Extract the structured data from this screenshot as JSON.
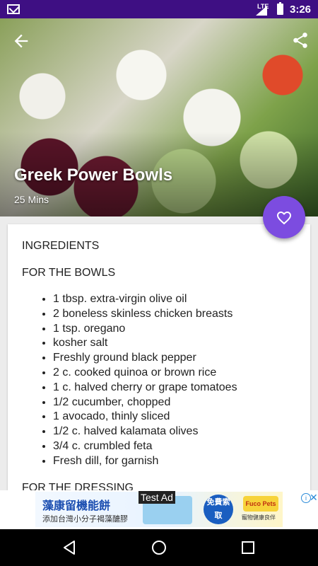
{
  "status_bar": {
    "network": "LTE",
    "time": "3:26"
  },
  "recipe": {
    "title": "Greek Power Bowls",
    "duration": "25 Mins"
  },
  "ingredients": {
    "heading": "INGREDIENTS",
    "bowls_heading": "FOR THE BOWLS",
    "bowls_items": [
      "1 tbsp. extra-virgin olive oil",
      "2 boneless skinless chicken breasts",
      "1 tsp. oregano",
      "kosher salt",
      "Freshly ground black pepper",
      "2 c. cooked quinoa or brown rice",
      "1 c. halved cherry or grape tomatoes",
      "1/2 cucumber, chopped",
      "1 avocado, thinly sliced",
      "1/2 c. halved kalamata olives",
      "3/4 c. crumbled feta",
      "Fresh dill, for garnish"
    ],
    "dressing_heading": "FOR THE DRESSING"
  },
  "ad": {
    "label": "Test Ad",
    "headline": "藻康留機能餅",
    "subline": "添加台灣小分子褐藻醣膠",
    "cta": "免費索取",
    "brand": "Fuco Pets",
    "brand_sub": "寵物健康良伴",
    "info": "i",
    "close": "✕"
  },
  "colors": {
    "status_bar": "#3e0f83",
    "fab": "#7c4ce0"
  },
  "icons": {
    "back": "arrow-back-icon",
    "share": "share-icon",
    "favorite": "heart-outline-icon",
    "nav_back": "triangle-back-icon",
    "nav_home": "circle-home-icon",
    "nav_recents": "square-recents-icon"
  }
}
